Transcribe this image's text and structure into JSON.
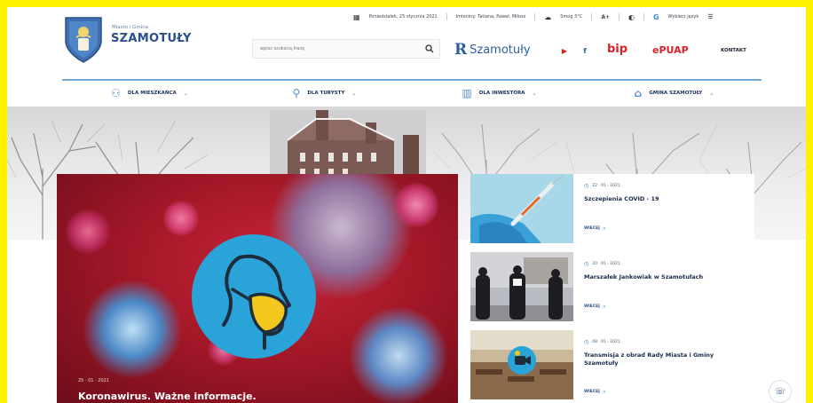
{
  "util": {
    "date": "Poniedziałek, 25 stycznia 2021",
    "nameday": "Imieniny: Tatiana, Paweł, Miłosz",
    "weather": "Smog 3°C",
    "font_size": "A+",
    "contrast": "◐",
    "translate": "Wybierz język"
  },
  "brand": {
    "small": "Miasto i Gmina",
    "name": "SZAMOTUŁY"
  },
  "search": {
    "placeholder": "wpisz szukaną frazę"
  },
  "city_logo": {
    "letter": "R",
    "text": "Szamotuły"
  },
  "header": {
    "youtube": "▶",
    "facebook": "f",
    "bip": "bip",
    "epuap": "ePUAP",
    "kontakt": "KONTAKT"
  },
  "nav": [
    {
      "label": "DLA MIESZKAŃCA"
    },
    {
      "label": "DLA TURYSTY"
    },
    {
      "label": "DLA INWESTORA"
    },
    {
      "label": "GMINA SZAMOTUŁY"
    }
  ],
  "feature": {
    "date": "25 · 01 · 2021",
    "title": "Koronawirus. Ważne informacje."
  },
  "news": [
    {
      "date": "22 · 01 · 2021",
      "title": "Szczepienia COVID - 19",
      "more": "WIĘCEJ"
    },
    {
      "date": "20 · 01 · 2021",
      "title": "Marszałek Jankowiak w Szamotułach",
      "more": "WIĘCEJ"
    },
    {
      "date": "08 · 01 · 2021",
      "title": "Transmisja z obrad Rady Miasta i Gminy Szamotuły",
      "more": "WIĘCEJ"
    }
  ],
  "colors": {
    "frame": "#fff200",
    "accent": "#2a4f8a",
    "nav_line": "#6ea9d8",
    "feature_bg": "#a41828",
    "mask_circle": "#2aa3d9"
  }
}
